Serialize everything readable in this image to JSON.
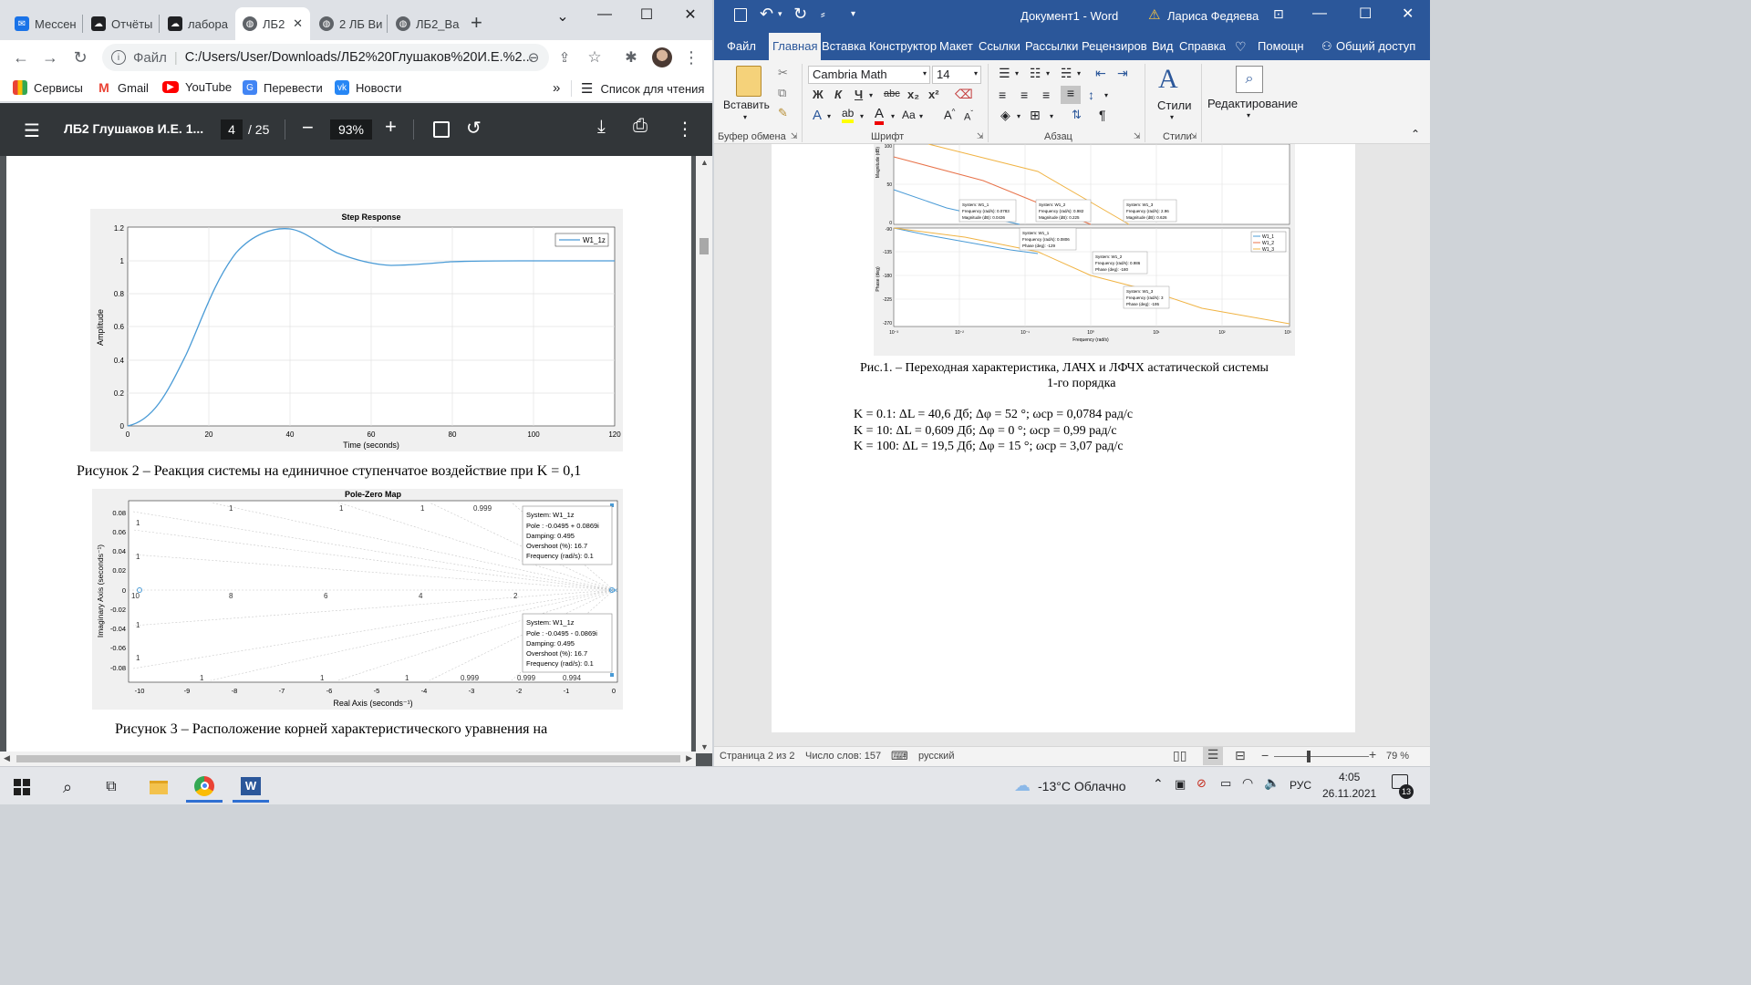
{
  "chrome": {
    "tabs": [
      {
        "label": "Мессен",
        "icon": "messenger-icon",
        "color": "#1a73e8"
      },
      {
        "label": "Отчёты",
        "icon": "cloud-icon",
        "color": "#202124"
      },
      {
        "label": "лабора",
        "icon": "cloud-icon",
        "color": "#202124"
      },
      {
        "label": "ЛБ2",
        "icon": "globe-icon",
        "color": "#202124",
        "active": true
      },
      {
        "label": "2 ЛБ Ви",
        "icon": "globe-icon",
        "color": "#202124"
      },
      {
        "label": "ЛБ2_Ва",
        "icon": "globe-icon",
        "color": "#202124"
      }
    ],
    "new_tab": "+",
    "address_prefix": "Файл",
    "address": "C:/Users/User/Downloads/ЛБ2%20Глушаков%20И.Е.%2...",
    "bookmarks": [
      {
        "label": "Сервисы",
        "icon": "apps-icon"
      },
      {
        "label": "Gmail",
        "icon": "gmail-icon"
      },
      {
        "label": "YouTube",
        "icon": "youtube-icon"
      },
      {
        "label": "Перевести",
        "icon": "translate-icon"
      },
      {
        "label": "Новости",
        "icon": "vk-icon"
      }
    ],
    "bookmarks_more": "»",
    "reading_list": "Список для чтения"
  },
  "pdf": {
    "title": "ЛБ2 Глушаков И.Е. 1...",
    "page_current": "4",
    "page_total": "/ 25",
    "zoom": "93%",
    "fig2_caption": "Рисунок 2 – Реакция системы на единичное ступенчатое воздействие при K = 0,1",
    "fig3_caption": "Рисунок 3 – Расположение корней характеристического уравнения на",
    "step": {
      "title": "Step Response",
      "ylabel": "Amplitude",
      "xlabel": "Time (seconds)",
      "legend": "W1_1z",
      "xticks": [
        "0",
        "20",
        "40",
        "60",
        "80",
        "100",
        "120"
      ],
      "yticks": [
        "0",
        "0.2",
        "0.4",
        "0.6",
        "0.8",
        "1",
        "1.2"
      ]
    },
    "pz": {
      "title": "Pole-Zero Map",
      "ylabel": "Imaginary Axis (seconds⁻¹)",
      "xlabel": "Real Axis (seconds⁻¹)",
      "xticks": [
        "-10",
        "-9",
        "-8",
        "-7",
        "-6",
        "-5",
        "-4",
        "-3",
        "-2",
        "-1",
        "0"
      ],
      "yticks": [
        "0.08",
        "0.06",
        "0.04",
        "0.02",
        "0",
        "-0.02",
        "-0.04",
        "-0.06",
        "-0.08"
      ],
      "grid_top": [
        "1",
        "1",
        "1",
        "0.999"
      ],
      "grid_mid": [
        "10",
        "8",
        "6",
        "4",
        "2"
      ],
      "grid_left": [
        "1",
        "1",
        "1",
        "1"
      ],
      "grid_bottom": [
        "1",
        "1",
        "1",
        "0.999",
        "0.999",
        "0.994"
      ],
      "tip1": [
        "System: W1_1z",
        "Pole : -0.0495 + 0.0869i",
        "Damping: 0.495",
        "Overshoot (%): 16.7",
        "Frequency (rad/s): 0.1"
      ],
      "tip2": [
        "System: W1_1z",
        "Pole : -0.0495 - 0.0869i",
        "Damping: 0.495",
        "Overshoot (%): 16.7",
        "Frequency (rad/s): 0.1"
      ]
    }
  },
  "word": {
    "doc_title": "Документ1 - Word",
    "user": "Лариса Федяева",
    "tabs": [
      "Файл",
      "Главная",
      "Вставка",
      "Конструктор",
      "Макет",
      "Ссылки",
      "Рассылки",
      "Рецензиров",
      "Вид",
      "Справка",
      "Помощн",
      "Общий доступ"
    ],
    "font": "Cambria Math",
    "font_size": "14",
    "paste": "Вставить",
    "styles": "Стили",
    "editing": "Редактирование",
    "group_labels": [
      "Буфер обмена",
      "Шрифт",
      "Абзац",
      "Стили"
    ],
    "fig_caption_1": "Рис.1. – Переходная характеристика, ЛАЧХ и ЛФЧХ астатической системы",
    "fig_caption_2": "1-го порядка",
    "lines": [
      "K = 0.1: ΔL = 40,6 Дб; Δφ = 52 °; ωср = 0,0784 рад/с",
      "K = 10: ΔL = 0,609 Дб; Δφ = 0 °; ωср = 0,99 рад/с",
      "K = 100: ΔL = 19,5 Дб; Δφ = 15 °; ωср = 3,07 рад/с"
    ],
    "bode": {
      "mag_label": "Magnitude (dB)",
      "phase_label": "Phase (deg)",
      "xlabel": "Frequency (rad/s)",
      "legend": [
        "W1_1",
        "W1_2",
        "W1_3"
      ],
      "mag_yticks": [
        "100",
        "50",
        "0"
      ],
      "phase_yticks": [
        "-90",
        "-135",
        "-180",
        "-225",
        "-270"
      ],
      "xticks": [
        "10⁻³",
        "10⁻²",
        "10⁻¹",
        "10⁰",
        "10¹",
        "10²",
        "10³"
      ],
      "tips": [
        [
          "System: W1_1",
          "Frequency (rad/s): 0.0783",
          "Magnitude (dB): 0.0436"
        ],
        [
          "System: W1_2",
          "Frequency (rad/s): 0.982",
          "Magnitude (dB): 0.225"
        ],
        [
          "System: W1_3",
          "Frequency (rad/s): 2.96",
          "Magnitude (dB): 0.626"
        ],
        [
          "System: W1_1",
          "Frequency (rad/s): 0.0806",
          "Phase (deg): -129"
        ],
        [
          "System: W1_2",
          "Frequency (rad/s): 0.986",
          "Phase (deg): -180"
        ],
        [
          "System: W1_3",
          "Frequency (rad/s): 3",
          "Phase (deg): -195"
        ]
      ]
    },
    "status_page": "Страница 2 из 2",
    "status_words": "Число слов: 157",
    "status_lang": "русский",
    "zoom": "79 %"
  },
  "taskbar": {
    "weather": "-13°C  Облачно",
    "lang": "РУС",
    "time": "4:05",
    "date": "26.11.2021",
    "notif_count": "13"
  }
}
